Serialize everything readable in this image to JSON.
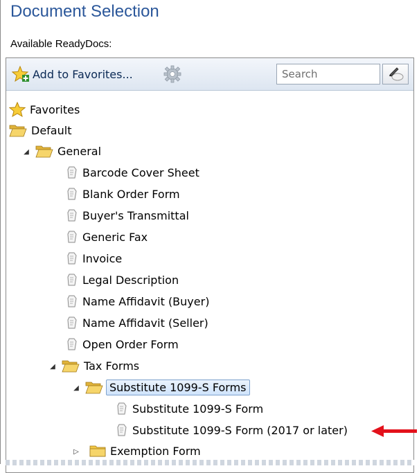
{
  "header": {
    "title": "Document Selection",
    "subtitle": "Available ReadyDocs:"
  },
  "toolbar": {
    "add_favorites_label": "Add to Favorites...",
    "search_placeholder": "Search"
  },
  "tree": {
    "favorites": "Favorites",
    "default": "Default",
    "general": "General",
    "general_items": [
      "Barcode Cover Sheet",
      "Blank Order Form",
      "Buyer's Transmittal",
      "Generic Fax",
      "Invoice",
      "Legal Description",
      "Name Affidavit (Buyer)",
      "Name Affidavit (Seller)",
      "Open Order Form"
    ],
    "tax_forms": "Tax Forms",
    "substitute_folder": "Substitute 1099-S Forms",
    "substitute_items": [
      "Substitute 1099-S Form",
      "Substitute 1099-S Form (2017 or later)"
    ],
    "exemption_form": "Exemption Form"
  },
  "colors": {
    "title": "#2b579a",
    "folder": "#f2c744",
    "arrow": "#e3111b",
    "selection": "#cfe3fb"
  }
}
